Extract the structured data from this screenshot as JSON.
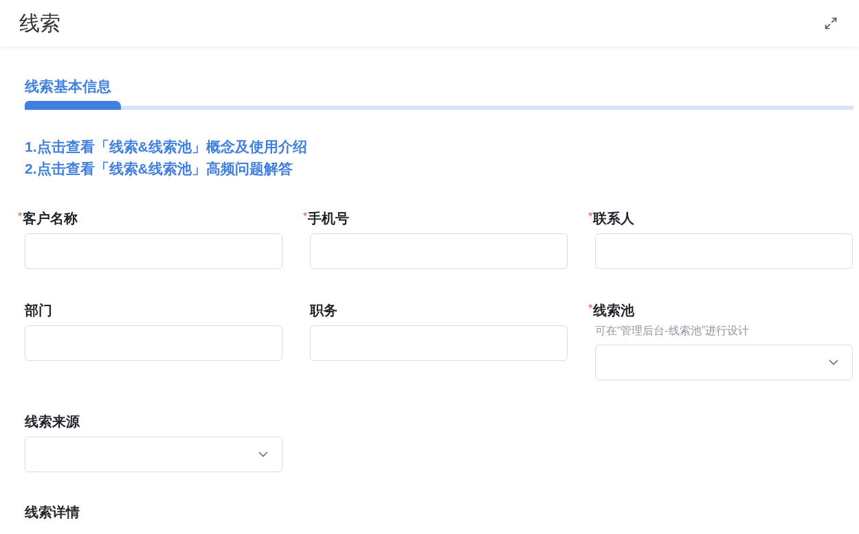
{
  "header": {
    "title": "线索"
  },
  "tabs": [
    {
      "label": "线索基本信息",
      "selected": true
    }
  ],
  "links": [
    "1.点击查看「线索&线索池」概念及使用介绍",
    "2.点击查看「线索&线索池」高频问题解答"
  ],
  "fields": [
    {
      "label": "客户名称",
      "marker": "*",
      "kind": "text"
    },
    {
      "label": "手机号",
      "marker": "*",
      "kind": "text"
    },
    {
      "label": "联系人",
      "marker": "*",
      "kind": "text"
    },
    {
      "label": "部门",
      "kind": "text"
    },
    {
      "label": "职务",
      "kind": "text"
    },
    {
      "label": "线索池",
      "marker": "*",
      "kind": "select",
      "hint": "可在“管理后台-线索池”进行设计"
    },
    {
      "label": "线索来源",
      "kind": "select"
    }
  ],
  "section": {
    "label": "线索详情"
  }
}
